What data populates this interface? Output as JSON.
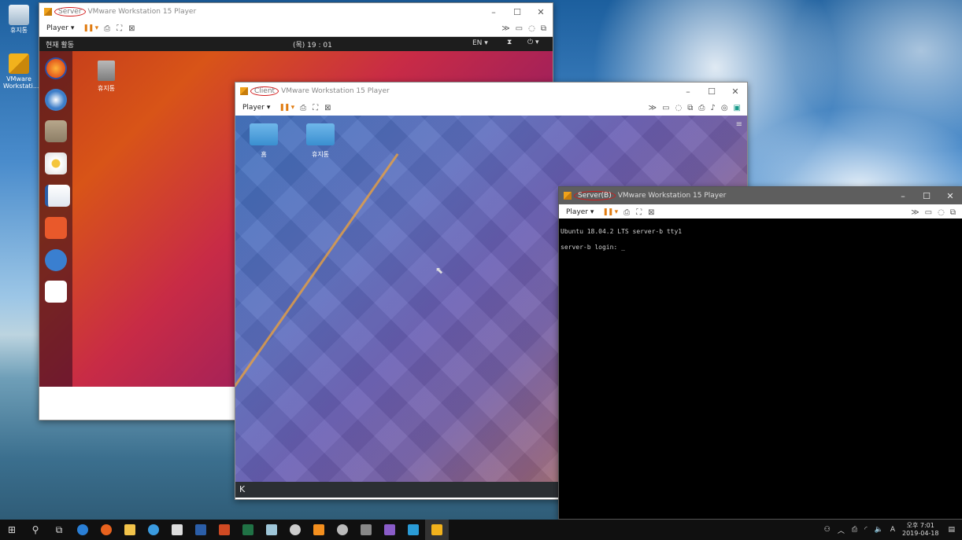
{
  "desktop": {
    "icons": [
      {
        "label": "휴지통",
        "icon": "recycle-bin-icon"
      },
      {
        "label": "VMware Workstati...",
        "icon": "vmware-icon"
      }
    ]
  },
  "server_window": {
    "vm_name": "Server",
    "app_title": "VMware Workstation 15 Player",
    "player_label": "Player ▾",
    "ubuntu": {
      "activities": "현재 활동",
      "clock": "(목) 19 : 01",
      "lang": "EN ▾",
      "trash_label": "휴지통",
      "dock": [
        "firefox-icon",
        "thunderbird-icon",
        "files-icon",
        "rhythmbox-icon",
        "writer-icon",
        "software-center-icon",
        "help-icon",
        "amazon-icon",
        "app-grid-icon"
      ]
    }
  },
  "client_window": {
    "vm_name": "Client",
    "app_title": "VMware Workstation 15 Player",
    "player_label": "Player ▾",
    "kde": {
      "home_label": "홈",
      "trash_label": "휴지통"
    }
  },
  "serverb_window": {
    "vm_name": "Server(B)",
    "app_title": "VMware Workstation 15 Player",
    "player_label": "Player ▾",
    "terminal": {
      "line1": "Ubuntu 18.04.2 LTS server-b tty1",
      "line2": "server-b login: _"
    }
  },
  "taskbar": {
    "clock_time": "오후 7:01",
    "clock_date": "2019-04-18",
    "ime": "A"
  },
  "colors": {
    "vmname_circle": "#d21a1a",
    "pause": "#e07b10"
  }
}
